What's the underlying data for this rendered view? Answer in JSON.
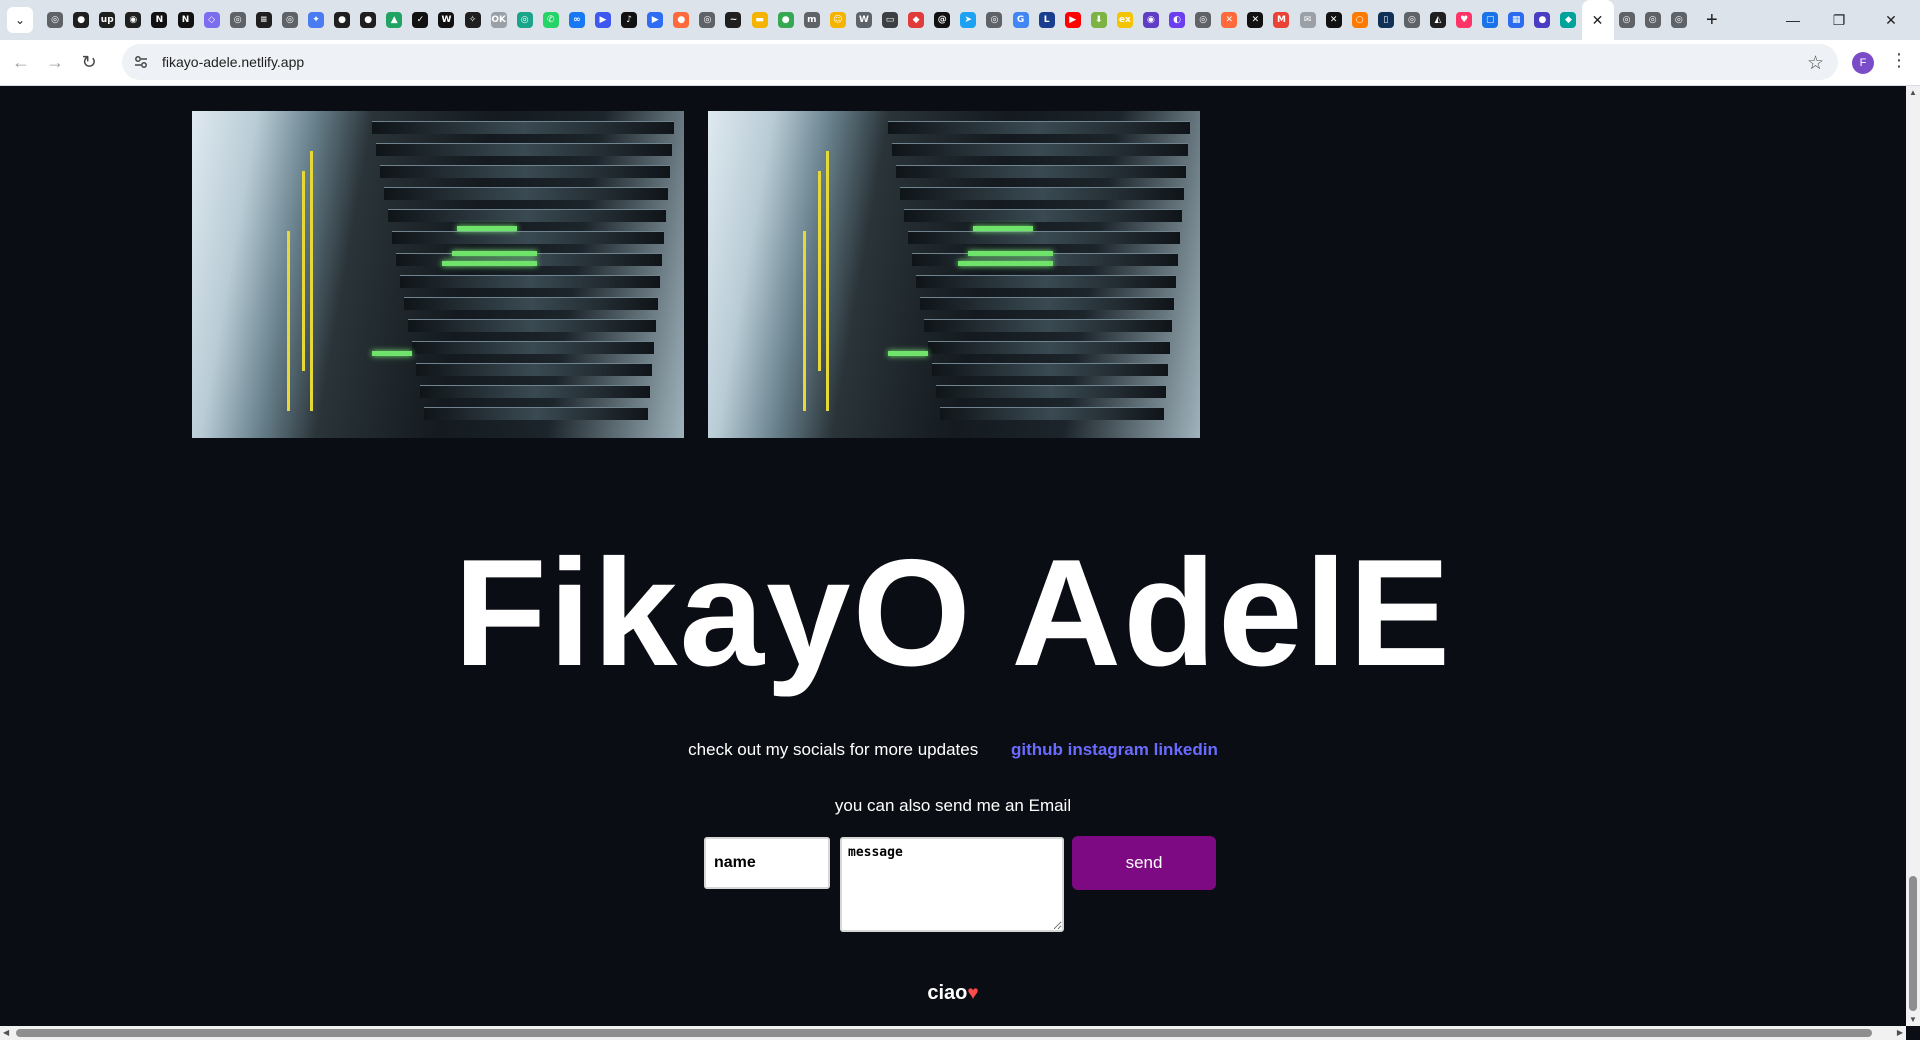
{
  "browser": {
    "url": "fikayo-adele.netlify.app",
    "profile_initial": "F",
    "tab_favicons": [
      {
        "icon": "chrome-icon",
        "color": "#5f6368",
        "glyph": "◎"
      },
      {
        "icon": "github-icon",
        "color": "#1f1f1f",
        "glyph": "●"
      },
      {
        "icon": "upwork-icon",
        "color": "#1f1f1f",
        "glyph": "up"
      },
      {
        "icon": "circle-target-icon",
        "color": "#1f1f1f",
        "glyph": "◉"
      },
      {
        "icon": "notion-icon",
        "color": "#111111",
        "glyph": "N"
      },
      {
        "icon": "notion-icon",
        "color": "#111111",
        "glyph": "N"
      },
      {
        "icon": "cube-icon",
        "color": "#7c6cf0",
        "glyph": "◇"
      },
      {
        "icon": "globe-icon",
        "color": "#5f6368",
        "glyph": "◎"
      },
      {
        "icon": "layers-icon",
        "color": "#1f1f1f",
        "glyph": "≡"
      },
      {
        "icon": "globe-icon",
        "color": "#5f6368",
        "glyph": "◎"
      },
      {
        "icon": "gemini-icon",
        "color": "#4a7bf0",
        "glyph": "✦"
      },
      {
        "icon": "github-icon",
        "color": "#1f1f1f",
        "glyph": "●"
      },
      {
        "icon": "github-icon",
        "color": "#1f1f1f",
        "glyph": "●"
      },
      {
        "icon": "drive-icon",
        "color": "#1fa463",
        "glyph": "▲"
      },
      {
        "icon": "check-icon",
        "color": "#111111",
        "glyph": "✓"
      },
      {
        "icon": "wtf-icon",
        "color": "#111111",
        "glyph": "W"
      },
      {
        "icon": "star-compass-icon",
        "color": "#1f1f1f",
        "glyph": "✧"
      },
      {
        "icon": "ok-icon",
        "color": "#9aa0a6",
        "glyph": "OK"
      },
      {
        "icon": "teal-circle-icon",
        "color": "#1aa58a",
        "glyph": "◎"
      },
      {
        "icon": "whatsapp-icon",
        "color": "#25d366",
        "glyph": "✆"
      },
      {
        "icon": "meta-icon",
        "color": "#1877f2",
        "glyph": "∞"
      },
      {
        "icon": "video-icon",
        "color": "#3d57f0",
        "glyph": "▶"
      },
      {
        "icon": "tiktok-icon",
        "color": "#111111",
        "glyph": "♪"
      },
      {
        "icon": "video-icon",
        "color": "#2f6df5",
        "glyph": "▶"
      },
      {
        "icon": "orange-icon",
        "color": "#ff6a3d",
        "glyph": "●"
      },
      {
        "icon": "globe-icon",
        "color": "#5f6368",
        "glyph": "◎"
      },
      {
        "icon": "wave-icon",
        "color": "#1f1f1f",
        "glyph": "~"
      },
      {
        "icon": "folder-icon",
        "color": "#f4b400",
        "glyph": "▬"
      },
      {
        "icon": "green-dot-icon",
        "color": "#34a853",
        "glyph": "●"
      },
      {
        "icon": "m-icon",
        "color": "#5f6368",
        "glyph": "m"
      },
      {
        "icon": "emoji-icon",
        "color": "#f4b400",
        "glyph": "☺"
      },
      {
        "icon": "wiki-icon",
        "color": "#5f6368",
        "glyph": "W"
      },
      {
        "icon": "card-icon",
        "color": "#3c4043",
        "glyph": "▭"
      },
      {
        "icon": "red-tag-icon",
        "color": "#e03c3c",
        "glyph": "◆"
      },
      {
        "icon": "threads-icon",
        "color": "#111111",
        "glyph": "@"
      },
      {
        "icon": "arrow-icon",
        "color": "#1da1f2",
        "glyph": "➤"
      },
      {
        "icon": "globe-icon",
        "color": "#5f6368",
        "glyph": "◎"
      },
      {
        "icon": "google-icon",
        "color": "#4285f4",
        "glyph": "G"
      },
      {
        "icon": "l-icon",
        "color": "#1a3e8f",
        "glyph": "L"
      },
      {
        "icon": "youtube-icon",
        "color": "#ff0000",
        "glyph": "▶"
      },
      {
        "icon": "android-icon",
        "color": "#7cb342",
        "glyph": "⬇"
      },
      {
        "icon": "ex-icon",
        "color": "#f4c400",
        "glyph": "ex"
      },
      {
        "icon": "aura-icon",
        "color": "#5f3dc4",
        "glyph": "◉"
      },
      {
        "icon": "swirl-icon",
        "color": "#6b3ff0",
        "glyph": "◐"
      },
      {
        "icon": "globe-icon",
        "color": "#5f6368",
        "glyph": "◎"
      },
      {
        "icon": "orange-x-icon",
        "color": "#ff6a3d",
        "glyph": "✕"
      },
      {
        "icon": "x-icon",
        "color": "#111111",
        "glyph": "✕"
      },
      {
        "icon": "gmail-icon",
        "color": "#ea4335",
        "glyph": "M"
      },
      {
        "icon": "mail-icon",
        "color": "#9aa0a6",
        "glyph": "✉"
      },
      {
        "icon": "x-icon",
        "color": "#111111",
        "glyph": "✕"
      },
      {
        "icon": "ring-icon",
        "color": "#ff7a00",
        "glyph": "○"
      },
      {
        "icon": "mobile-icon",
        "color": "#0f3057",
        "glyph": "▯"
      },
      {
        "icon": "globe-icon",
        "color": "#5f6368",
        "glyph": "◎"
      },
      {
        "icon": "mountain-icon",
        "color": "#1f1f1f",
        "glyph": "◭"
      },
      {
        "icon": "heart-icon",
        "color": "#ff3366",
        "glyph": "♥"
      },
      {
        "icon": "square-icon",
        "color": "#1a73e8",
        "glyph": "▢"
      },
      {
        "icon": "grid-icon",
        "color": "#2b6cf0",
        "glyph": "▦"
      },
      {
        "icon": "planet-icon",
        "color": "#4a3dc4",
        "glyph": "●"
      },
      {
        "icon": "diamond-icon",
        "color": "#00a39a",
        "glyph": "◆"
      }
    ],
    "active_tab_close": "✕",
    "after_tabs": [
      {
        "icon": "globe-icon",
        "color": "#5f6368",
        "glyph": "◎"
      },
      {
        "icon": "chrome-icon",
        "color": "#5f6368",
        "glyph": "◎"
      },
      {
        "icon": "chrome-icon",
        "color": "#5f6368",
        "glyph": "◎"
      }
    ]
  },
  "page": {
    "title": "FikayO AdelE",
    "socials_prompt": "check out my socials for more updates",
    "social_links": [
      "github",
      "instagram",
      "linkedin"
    ],
    "email_prompt": "you can also send me an Email",
    "form": {
      "name_placeholder": "name",
      "message_placeholder": "message",
      "send_label": "send"
    },
    "footer": "ciao",
    "footer_icon": "heart-icon"
  }
}
